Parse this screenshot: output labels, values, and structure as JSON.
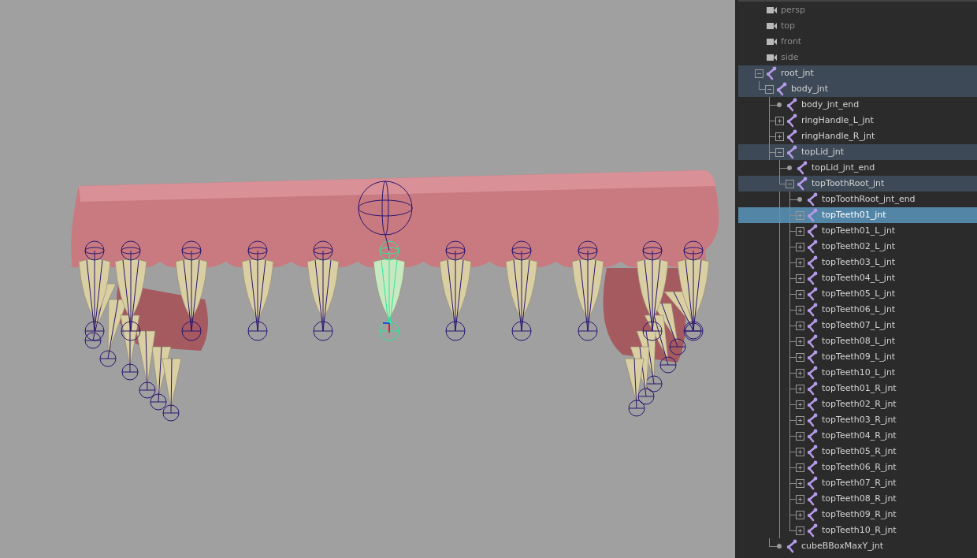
{
  "outliner": {
    "items": [
      {
        "kind": "camera",
        "label": "persp",
        "selected": false,
        "highlighted": false
      },
      {
        "kind": "camera",
        "label": "top",
        "selected": false,
        "highlighted": false
      },
      {
        "kind": "camera",
        "label": "front",
        "selected": false,
        "highlighted": false
      },
      {
        "kind": "camera",
        "label": "side",
        "selected": false,
        "highlighted": false
      },
      {
        "kind": "joint",
        "label": "root_jnt",
        "selected": false,
        "highlighted": true,
        "expanded": true,
        "children": [
          {
            "kind": "joint",
            "label": "body_jnt",
            "selected": false,
            "highlighted": true,
            "expanded": true,
            "children": [
              {
                "kind": "leaf",
                "label": "body_jnt_end",
                "selected": false,
                "highlighted": false
              },
              {
                "kind": "joint",
                "label": "ringHandle_L_jnt",
                "selected": false,
                "highlighted": false,
                "expanded": false
              },
              {
                "kind": "joint",
                "label": "ringHandle_R_jnt",
                "selected": false,
                "highlighted": false,
                "expanded": false
              },
              {
                "kind": "joint",
                "label": "topLid_jnt",
                "selected": false,
                "highlighted": true,
                "expanded": true,
                "children": [
                  {
                    "kind": "leaf",
                    "label": "topLid_jnt_end",
                    "selected": false,
                    "highlighted": false
                  },
                  {
                    "kind": "joint",
                    "label": "topToothRoot_jnt",
                    "selected": false,
                    "highlighted": true,
                    "expanded": true,
                    "children": [
                      {
                        "kind": "leaf",
                        "label": "topToothRoot_jnt_end",
                        "selected": false,
                        "highlighted": false
                      },
                      {
                        "kind": "joint",
                        "label": "topTeeth01_jnt",
                        "selected": true,
                        "highlighted": false,
                        "expanded": false
                      },
                      {
                        "kind": "joint",
                        "label": "topTeeth01_L_jnt",
                        "selected": false,
                        "highlighted": false,
                        "expanded": false
                      },
                      {
                        "kind": "joint",
                        "label": "topTeeth02_L_jnt",
                        "selected": false,
                        "highlighted": false,
                        "expanded": false
                      },
                      {
                        "kind": "joint",
                        "label": "topTeeth03_L_jnt",
                        "selected": false,
                        "highlighted": false,
                        "expanded": false
                      },
                      {
                        "kind": "joint",
                        "label": "topTeeth04_L_jnt",
                        "selected": false,
                        "highlighted": false,
                        "expanded": false
                      },
                      {
                        "kind": "joint",
                        "label": "topTeeth05_L_jnt",
                        "selected": false,
                        "highlighted": false,
                        "expanded": false
                      },
                      {
                        "kind": "joint",
                        "label": "topTeeth06_L_jnt",
                        "selected": false,
                        "highlighted": false,
                        "expanded": false
                      },
                      {
                        "kind": "joint",
                        "label": "topTeeth07_L_jnt",
                        "selected": false,
                        "highlighted": false,
                        "expanded": false
                      },
                      {
                        "kind": "joint",
                        "label": "topTeeth08_L_jnt",
                        "selected": false,
                        "highlighted": false,
                        "expanded": false
                      },
                      {
                        "kind": "joint",
                        "label": "topTeeth09_L_jnt",
                        "selected": false,
                        "highlighted": false,
                        "expanded": false
                      },
                      {
                        "kind": "joint",
                        "label": "topTeeth10_L_jnt",
                        "selected": false,
                        "highlighted": false,
                        "expanded": false
                      },
                      {
                        "kind": "joint",
                        "label": "topTeeth01_R_jnt",
                        "selected": false,
                        "highlighted": false,
                        "expanded": false
                      },
                      {
                        "kind": "joint",
                        "label": "topTeeth02_R_jnt",
                        "selected": false,
                        "highlighted": false,
                        "expanded": false
                      },
                      {
                        "kind": "joint",
                        "label": "topTeeth03_R_jnt",
                        "selected": false,
                        "highlighted": false,
                        "expanded": false
                      },
                      {
                        "kind": "joint",
                        "label": "topTeeth04_R_jnt",
                        "selected": false,
                        "highlighted": false,
                        "expanded": false
                      },
                      {
                        "kind": "joint",
                        "label": "topTeeth05_R_jnt",
                        "selected": false,
                        "highlighted": false,
                        "expanded": false
                      },
                      {
                        "kind": "joint",
                        "label": "topTeeth06_R_jnt",
                        "selected": false,
                        "highlighted": false,
                        "expanded": false
                      },
                      {
                        "kind": "joint",
                        "label": "topTeeth07_R_jnt",
                        "selected": false,
                        "highlighted": false,
                        "expanded": false
                      },
                      {
                        "kind": "joint",
                        "label": "topTeeth08_R_jnt",
                        "selected": false,
                        "highlighted": false,
                        "expanded": false
                      },
                      {
                        "kind": "joint",
                        "label": "topTeeth09_R_jnt",
                        "selected": false,
                        "highlighted": false,
                        "expanded": false
                      },
                      {
                        "kind": "joint",
                        "label": "topTeeth10_R_jnt",
                        "selected": false,
                        "highlighted": false,
                        "expanded": false
                      }
                    ]
                  }
                ]
              },
              {
                "kind": "leaf",
                "label": "cubeBBoxMaxY_jnt",
                "selected": false,
                "highlighted": false
              }
            ]
          }
        ]
      }
    ]
  }
}
